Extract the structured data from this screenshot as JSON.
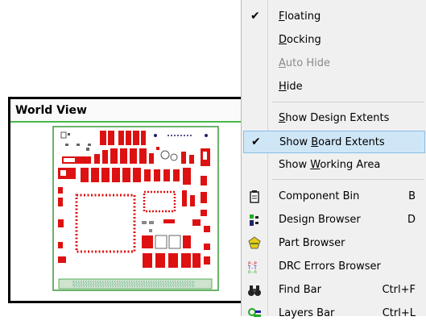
{
  "world_view": {
    "title": "World View"
  },
  "menu": {
    "items": [
      {
        "pre": "",
        "u": "F",
        "post": "loating",
        "checked": true,
        "disabled": false,
        "shortcut": "",
        "icon": ""
      },
      {
        "pre": "",
        "u": "D",
        "post": "ocking",
        "checked": false,
        "disabled": false,
        "shortcut": "",
        "icon": ""
      },
      {
        "pre": "",
        "u": "A",
        "post": "uto Hide",
        "checked": false,
        "disabled": true,
        "shortcut": "",
        "icon": ""
      },
      {
        "pre": "",
        "u": "H",
        "post": "ide",
        "checked": false,
        "disabled": false,
        "shortcut": "",
        "icon": ""
      },
      {
        "pre": "",
        "u": "S",
        "post": "how Design Extents",
        "checked": false,
        "disabled": false,
        "shortcut": "",
        "icon": ""
      },
      {
        "pre": "Show ",
        "u": "B",
        "post": "oard Extents",
        "checked": true,
        "disabled": false,
        "shortcut": "",
        "icon": "",
        "highlight": true
      },
      {
        "pre": "Show ",
        "u": "W",
        "post": "orking Area",
        "checked": false,
        "disabled": false,
        "shortcut": "",
        "icon": ""
      },
      {
        "pre": "Component Bin",
        "u": "",
        "post": "",
        "checked": false,
        "disabled": false,
        "shortcut": "B",
        "icon": "component-bin-icon"
      },
      {
        "pre": "Design Browser",
        "u": "",
        "post": "",
        "checked": false,
        "disabled": false,
        "shortcut": "D",
        "icon": "design-browser-icon"
      },
      {
        "pre": "Part Browser",
        "u": "",
        "post": "",
        "checked": false,
        "disabled": false,
        "shortcut": "",
        "icon": "part-browser-icon"
      },
      {
        "pre": "DRC Errors Browser",
        "u": "",
        "post": "",
        "checked": false,
        "disabled": false,
        "shortcut": "",
        "icon": "drc-errors-icon"
      },
      {
        "pre": "Find Bar",
        "u": "",
        "post": "",
        "checked": false,
        "disabled": false,
        "shortcut": "Ctrl+F",
        "icon": "binoculars-icon"
      },
      {
        "pre": "Layers Bar",
        "u": "",
        "post": "",
        "checked": false,
        "disabled": false,
        "shortcut": "Ctrl+L",
        "icon": "layers-bar-icon"
      }
    ]
  },
  "colors": {
    "highlight": "#cfe6f7",
    "highlight_border": "#86bfe8",
    "pad": "#dd1111",
    "board_outline": "#3a9a3a"
  }
}
